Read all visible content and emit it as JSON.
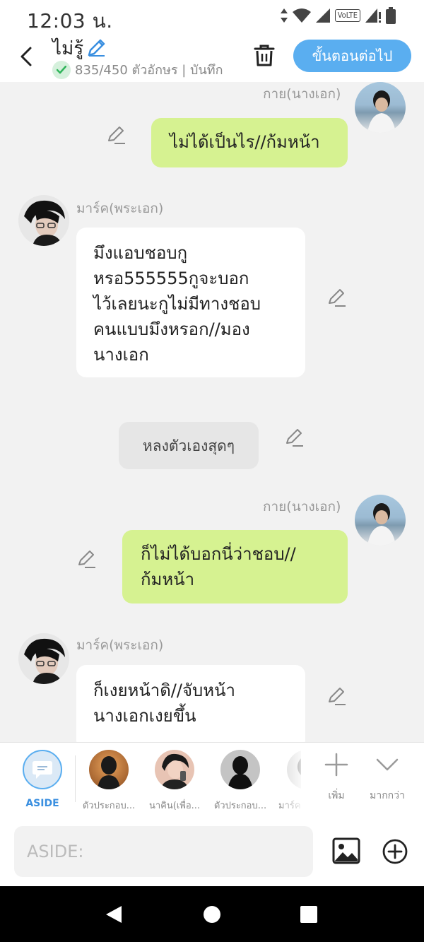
{
  "status_bar": {
    "time": "12:03 น.",
    "icons": [
      "data-arrows-icon",
      "wifi-icon",
      "signal-icon",
      "volte-icon",
      "signal-alert-icon",
      "battery-icon"
    ],
    "volte_label": "VoLTE"
  },
  "header": {
    "title": "ไม่รู้",
    "char_count": "835/450 ตัวอักษร | บันทึก",
    "next_button": "ขั้นตอนต่อไป",
    "accent_color": "#5aaef0"
  },
  "messages": [
    {
      "side": "right",
      "name": "กาย(นางเอก)",
      "text": "ไม่ได้เป็นไร//ก้มหน้า",
      "color": "green"
    },
    {
      "side": "left",
      "name": "มาร์ค(พระเอก)",
      "lines": [
        "มึงแอบชอบกู",
        "หรอ555555กูจะบอก",
        "ไว้เลยนะกูไม่มีทางชอบ",
        "คนแบบมึงหรอก//มอง",
        "นางเอก"
      ],
      "color": "white"
    },
    {
      "side": "center",
      "text": "หลงตัวเองสุดๆ",
      "color": "gray"
    },
    {
      "side": "right",
      "name": "กาย(นางเอก)",
      "lines": [
        "ก็ไม่ได้บอกนี่ว่าชอบ//",
        "ก้มหน้า"
      ],
      "color": "green"
    },
    {
      "side": "left",
      "name": "มาร์ค(พระเอก)",
      "lines": [
        "ก็เงยหน้าดิ//จับหน้า",
        "นางเอกเงยขึ้น"
      ],
      "color": "white"
    }
  ],
  "character_bar": {
    "items": [
      {
        "label": "ASIDE",
        "selected": true
      },
      {
        "label": "ตัวประกอบ..."
      },
      {
        "label": "นาคิน(เพื่อ..."
      },
      {
        "label": "ตัวประกอบ..."
      },
      {
        "label": "มาร์ค"
      }
    ],
    "add_label": "เพิ่ม",
    "more_label": "มากกว่า"
  },
  "input": {
    "placeholder": "ASIDE:",
    "value": ""
  },
  "nav": {
    "icons": [
      "back-triangle-icon",
      "home-circle-icon",
      "recents-square-icon"
    ]
  }
}
